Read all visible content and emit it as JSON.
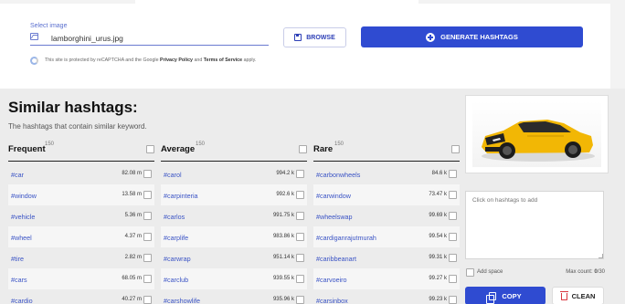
{
  "upload": {
    "label": "Select image",
    "file_name": "lamborghini_urus.jpg",
    "browse_label": "BROWSE",
    "generate_label": "GENERATE HASHTAGS",
    "recaptcha_prefix": "This site is protected by reCAPTCHA and the Google",
    "privacy_label": "Privacy Policy",
    "recaptcha_and": "and",
    "terms_label": "Terms of Service",
    "recaptcha_suffix": "apply."
  },
  "results": {
    "title": "Similar hashtags:",
    "subtitle": "The hashtags that contain similar keyword.",
    "columns": [
      {
        "title": "Frequent",
        "count": "150",
        "rows": [
          {
            "tag": "#car",
            "count": "82.08 m"
          },
          {
            "tag": "#window",
            "count": "13.58 m"
          },
          {
            "tag": "#vehicle",
            "count": "5.36 m"
          },
          {
            "tag": "#wheel",
            "count": "4.37 m"
          },
          {
            "tag": "#tire",
            "count": "2.82 m"
          },
          {
            "tag": "#cars",
            "count": "68.05 m"
          },
          {
            "tag": "#cardio",
            "count": "40.27 m"
          }
        ]
      },
      {
        "title": "Average",
        "count": "150",
        "rows": [
          {
            "tag": "#carol",
            "count": "994.2 k"
          },
          {
            "tag": "#carpinteria",
            "count": "992.6 k"
          },
          {
            "tag": "#carlos",
            "count": "991.75 k"
          },
          {
            "tag": "#carplife",
            "count": "983.86 k"
          },
          {
            "tag": "#carwrap",
            "count": "951.14 k"
          },
          {
            "tag": "#carclub",
            "count": "939.55 k"
          },
          {
            "tag": "#carshowlife",
            "count": "935.96 k"
          }
        ]
      },
      {
        "title": "Rare",
        "count": "150",
        "rows": [
          {
            "tag": "#carbonwheels",
            "count": "84.6 k"
          },
          {
            "tag": "#carwindow",
            "count": "73.47 k"
          },
          {
            "tag": "#wheelswap",
            "count": "99.69 k"
          },
          {
            "tag": "#cardiganrajutmurah",
            "count": "99.54 k"
          },
          {
            "tag": "#caribbeanart",
            "count": "99.31 k"
          },
          {
            "tag": "#carvoeiro",
            "count": "99.27 k"
          },
          {
            "tag": "#carsinbox",
            "count": "99.23 k"
          }
        ]
      }
    ]
  },
  "panel": {
    "textarea_placeholder": "Click on hashtags to add",
    "add_space_label": "Add space",
    "max_count_label": "Max count:",
    "max_count_value": "0",
    "max_count_limit": "/30",
    "copy_label": "COPY",
    "clean_label": "CLEAN"
  },
  "colors": {
    "accent": "#2f4bd1",
    "link": "#3a53c5",
    "car_body": "#f2b705",
    "clean_icon": "#d9363e"
  }
}
